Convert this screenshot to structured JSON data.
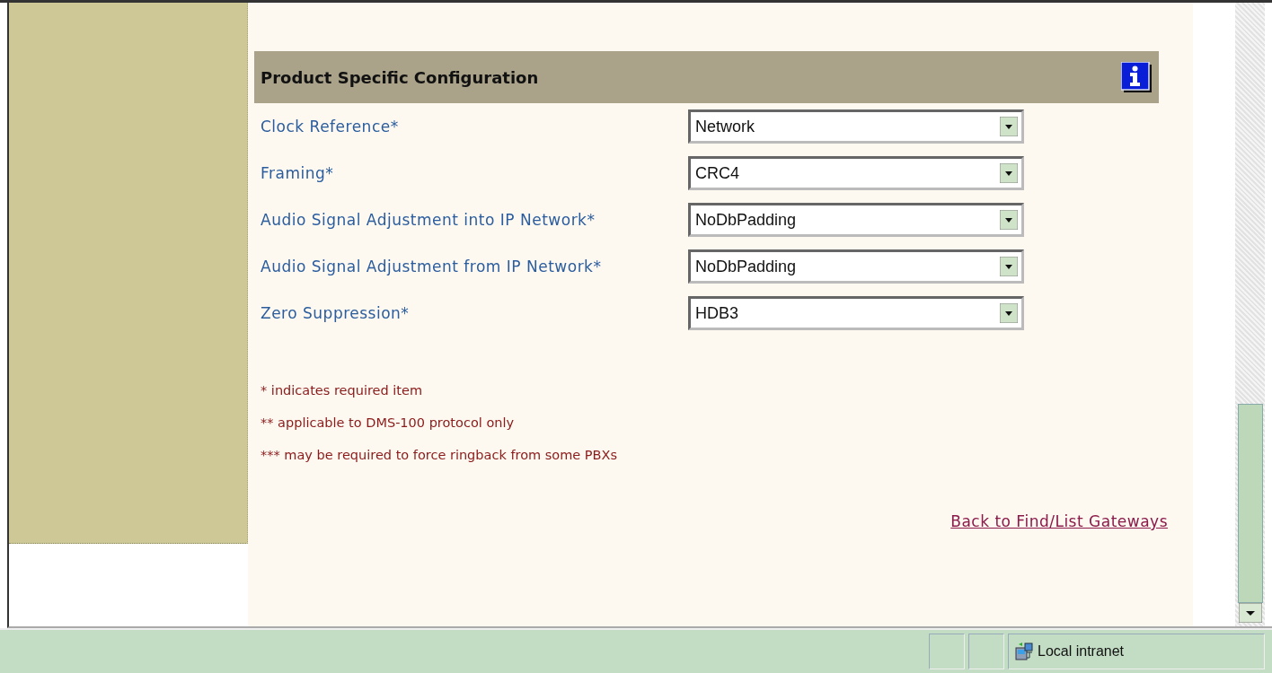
{
  "section": {
    "title": "Product Specific Configuration"
  },
  "fields": [
    {
      "label": "Clock Reference*",
      "value": "Network"
    },
    {
      "label": "Framing*",
      "value": "CRC4"
    },
    {
      "label": "Audio Signal Adjustment into IP Network*",
      "value": "NoDbPadding"
    },
    {
      "label": "Audio Signal Adjustment from IP Network*",
      "value": "NoDbPadding"
    },
    {
      "label": "Zero Suppression*",
      "value": "HDB3"
    }
  ],
  "notes": [
    "* indicates required item",
    "** applicable to DMS-100 protocol only",
    "*** may be required to force ringback from some PBXs"
  ],
  "link": "Back to Find/List Gateways",
  "status_bar": {
    "zone": "Local intranet"
  }
}
